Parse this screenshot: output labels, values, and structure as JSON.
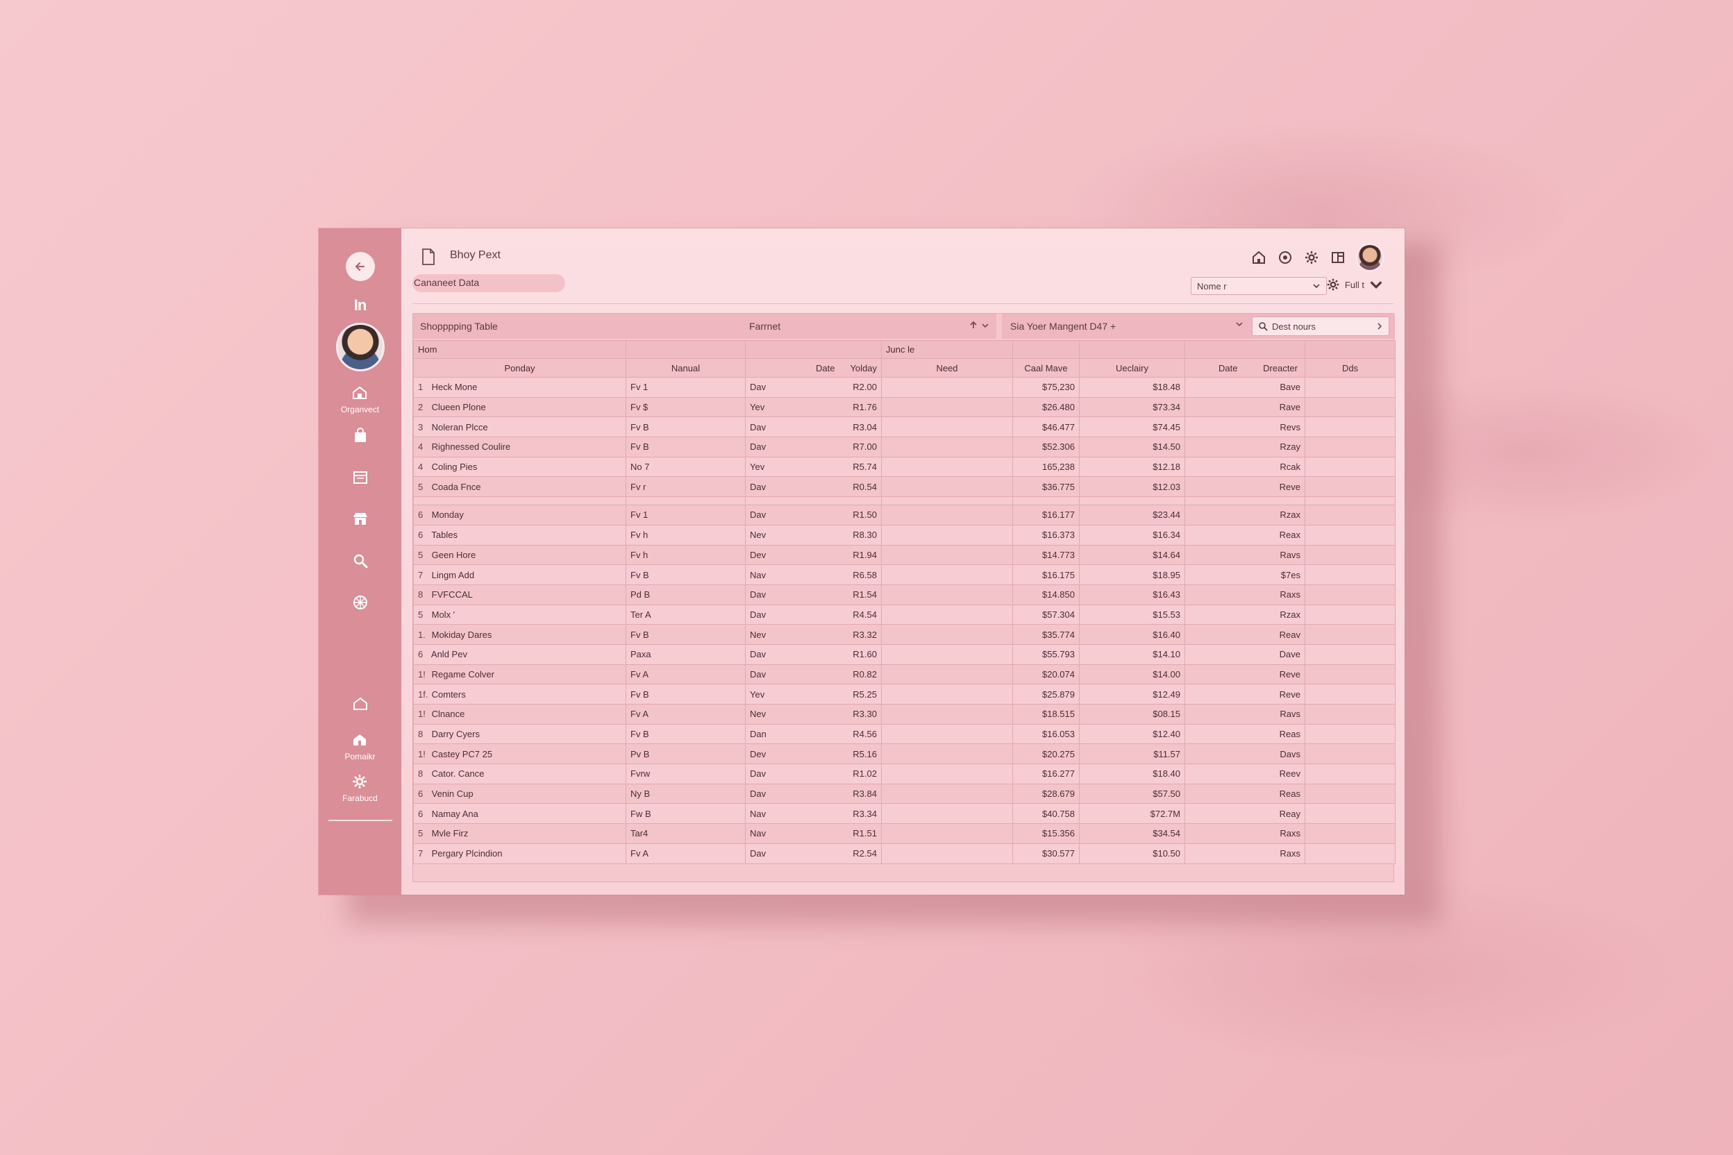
{
  "window": {
    "title": "Bhoy Pext",
    "breadcrumb": "Cananeet Data"
  },
  "sidebar": {
    "logo": "In",
    "items": [
      {
        "icon": "home-icon",
        "label": "Organvect"
      },
      {
        "icon": "bag-icon",
        "label": ""
      },
      {
        "icon": "calendar-icon",
        "label": ""
      },
      {
        "icon": "store-icon",
        "label": ""
      },
      {
        "icon": "search-icon",
        "label": ""
      },
      {
        "icon": "globe-icon",
        "label": ""
      },
      {
        "icon": "house-outline-icon",
        "label": ""
      },
      {
        "icon": "house-filled-icon",
        "label": "Pomaikr"
      },
      {
        "icon": "gear-icon",
        "label": "Farabucd"
      }
    ]
  },
  "header": {
    "name_select": "Nome r",
    "fullt_label": "Full t"
  },
  "toolbar": {
    "table_title": "Shopppping Table",
    "format_label": "Farrnet",
    "segment_select": "Sia Yoer Mangent D47 +",
    "search_placeholder": "Dest nours"
  },
  "table": {
    "group_headers": [
      "Hom",
      "Junc le"
    ],
    "columns": [
      "Ponday",
      "Nanual",
      "Date",
      "Yolday",
      "Need",
      "Caal Mave",
      "Ueclairy",
      "Date",
      "Dreacter",
      "Dds"
    ],
    "rows": [
      {
        "n": "1",
        "name": "Heck Mone",
        "manual": "Fv 1",
        "date": "Dav",
        "value": "R2.00",
        "need": "",
        "mave": "$75,230",
        "uec": "$18.48",
        "dreacter": "Bave"
      },
      {
        "n": "2",
        "name": "Clueen Plone",
        "manual": "Fv $",
        "date": "Yev",
        "value": "R1.76",
        "need": "",
        "mave": "$26.480",
        "uec": "$73.34",
        "dreacter": "Rave"
      },
      {
        "n": "3",
        "name": "Noleran Plcce",
        "manual": "Fv B",
        "date": "Dav",
        "value": "R3.04",
        "need": "",
        "mave": "$46.477",
        "uec": "$74.45",
        "dreacter": "Revs"
      },
      {
        "n": "4",
        "name": "Righnessed Coulire",
        "manual": "Fv B",
        "date": "Dav",
        "value": "R7.00",
        "need": "",
        "mave": "$52.306",
        "uec": "$14.50",
        "dreacter": "Rzay"
      },
      {
        "n": "4",
        "name": "Coling Pies",
        "manual": "No 7",
        "date": "Yev",
        "value": "R5.74",
        "need": "",
        "mave": "165,238",
        "uec": "$12.18",
        "dreacter": "Rcak"
      },
      {
        "n": "5",
        "name": "Coada Fnce",
        "manual": "Fv r",
        "date": "Dav",
        "value": "R0.54",
        "need": "",
        "mave": "$36.775",
        "uec": "$12.03",
        "dreacter": "Reve"
      },
      {
        "n": "6",
        "name": "Monday",
        "manual": "Fv 1",
        "date": "Dav",
        "value": "R1.50",
        "need": "",
        "mave": "$16.177",
        "uec": "$23.44",
        "dreacter": "Rzax"
      },
      {
        "n": "6",
        "name": "Tables",
        "manual": "Fv h",
        "date": "Nev",
        "value": "R8.30",
        "need": "",
        "mave": "$16.373",
        "uec": "$16.34",
        "dreacter": "Reax"
      },
      {
        "n": "5",
        "name": "Geen Hore",
        "manual": "Fv h",
        "date": "Dev",
        "value": "R1.94",
        "need": "",
        "mave": "$14.773",
        "uec": "$14.64",
        "dreacter": "Ravs"
      },
      {
        "n": "7",
        "name": "Lingm Add",
        "manual": "Fv B",
        "date": "Nav",
        "value": "R6.58",
        "need": "",
        "mave": "$16.175",
        "uec": "$18.95",
        "dreacter": "$7es"
      },
      {
        "n": "8",
        "name": "FVFCCAL",
        "manual": "Pd B",
        "date": "Dav",
        "value": "R1.54",
        "need": "",
        "mave": "$14.850",
        "uec": "$16.43",
        "dreacter": "Raxs"
      },
      {
        "n": "5",
        "name": "Molx '",
        "manual": "Ter A",
        "date": "Dav",
        "value": "R4.54",
        "need": "",
        "mave": "$57.304",
        "uec": "$15.53",
        "dreacter": "Rzax"
      },
      {
        "n": "1.",
        "name": "Mokiday Dares",
        "manual": "Fv B",
        "date": "Nev",
        "value": "R3.32",
        "need": "",
        "mave": "$35.774",
        "uec": "$16.40",
        "dreacter": "Reav"
      },
      {
        "n": "6",
        "name": "Anld Pev",
        "manual": "Paxa",
        "date": "Dav",
        "value": "R1.60",
        "need": "",
        "mave": "$55.793",
        "uec": "$14.10",
        "dreacter": "Dave"
      },
      {
        "n": "1!",
        "name": "Regame Colver",
        "manual": "Fv A",
        "date": "Dav",
        "value": "R0.82",
        "need": "",
        "mave": "$20.074",
        "uec": "$14.00",
        "dreacter": "Reve"
      },
      {
        "n": "1f.",
        "name": "Comters",
        "manual": "Fv B",
        "date": "Yev",
        "value": "R5.25",
        "need": "",
        "mave": "$25.879",
        "uec": "$12.49",
        "dreacter": "Reve"
      },
      {
        "n": "1!",
        "name": "Clnance",
        "manual": "Fv A",
        "date": "Nev",
        "value": "R3.30",
        "need": "",
        "mave": "$18.515",
        "uec": "$08.15",
        "dreacter": "Ravs"
      },
      {
        "n": "8",
        "name": "Darry Cyers",
        "manual": "Fv B",
        "date": "Dan",
        "value": "R4.56",
        "need": "",
        "mave": "$16.053",
        "uec": "$12.40",
        "dreacter": "Reas"
      },
      {
        "n": "1!",
        "name": "Castey PC7 25",
        "manual": "Pv B",
        "date": "Dev",
        "value": "R5.16",
        "need": "",
        "mave": "$20.275",
        "uec": "$11.57",
        "dreacter": "Davs"
      },
      {
        "n": "8",
        "name": "Cator. Cance",
        "manual": "Fvrw",
        "date": "Dav",
        "value": "R1.02",
        "need": "",
        "mave": "$16.277",
        "uec": "$18.40",
        "dreacter": "Reev"
      },
      {
        "n": "6",
        "name": "Venin Cup",
        "manual": "Ny B",
        "date": "Dav",
        "value": "R3.84",
        "need": "",
        "mave": "$28.679",
        "uec": "$57.50",
        "dreacter": "Reas"
      },
      {
        "n": "6",
        "name": "Namay Ana",
        "manual": "Fw B",
        "date": "Nav",
        "value": "R3.34",
        "need": "",
        "mave": "$40.758",
        "uec": "$72.7M",
        "dreacter": "Reay"
      },
      {
        "n": "5",
        "name": "Mvle Firz",
        "manual": "Tar4",
        "date": "Nav",
        "value": "R1.51",
        "need": "",
        "mave": "$15.356",
        "uec": "$34.54",
        "dreacter": "Raxs"
      },
      {
        "n": "7",
        "name": "Pergary Plcindion",
        "manual": "Fv A",
        "date": "Dav",
        "value": "R2.54",
        "need": "",
        "mave": "$30.577",
        "uec": "$10.50",
        "dreacter": "Raxs"
      }
    ]
  },
  "colors": {
    "background": "#f4c1c7",
    "sidebar": "#d98e98",
    "panel": "#f8d2d7",
    "text": "#4a2e34"
  }
}
